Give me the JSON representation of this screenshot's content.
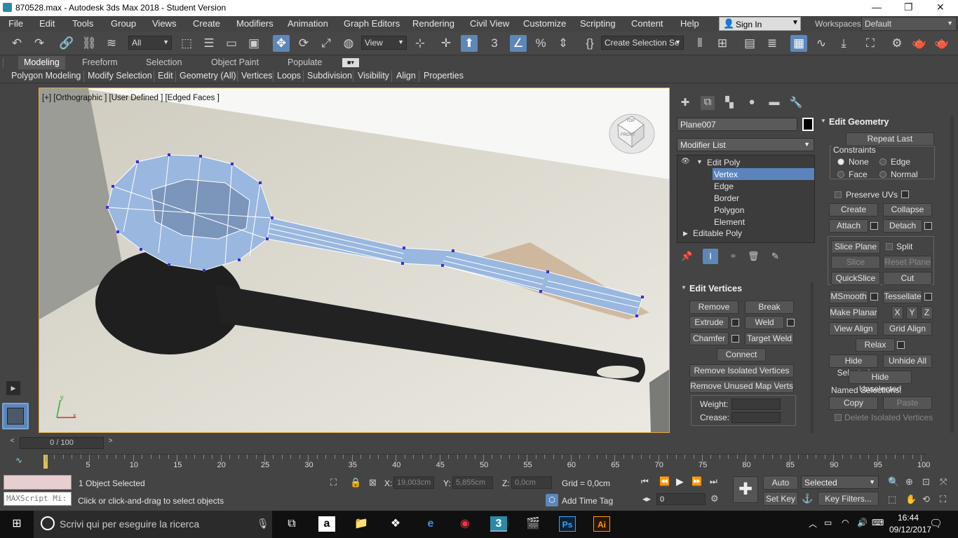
{
  "titlebar": {
    "title": "870528.max - Autodesk 3ds Max 2018 - Student Version",
    "minimize": "—",
    "maximize": "❐",
    "close": "✕"
  },
  "menubar": {
    "items": [
      "File",
      "Edit",
      "Tools",
      "Group",
      "Views",
      "Create",
      "Modifiers",
      "Animation",
      "Graph Editors",
      "Rendering",
      "Civil View",
      "Customize",
      "Scripting",
      "Content",
      "Help"
    ],
    "signin": "Sign In",
    "workspaces_label": "Workspaces:",
    "workspace": "Default"
  },
  "toolbar": {
    "filter": "All",
    "view": "View",
    "selection_set": "Create Selection Se",
    "snaps_3": "3"
  },
  "ribbon": {
    "tabs": [
      "Modeling",
      "Freeform",
      "Selection",
      "Object Paint",
      "Populate"
    ],
    "sub": [
      "Polygon Modeling",
      "Modify Selection",
      "Edit",
      "Geometry (All)",
      "Vertices",
      "Loops",
      "Subdivision",
      "Visibility",
      "Align",
      "Properties"
    ]
  },
  "viewport": {
    "label": "[+] [Orthographic ] [User Defined ] [Edged Faces ]",
    "viewcube_top": "TOP",
    "viewcube_front": "FRONT",
    "axis_x": "x",
    "axis_y": "y"
  },
  "cmdpanel": {
    "object_name": "Plane007",
    "modifier_list": "Modifier List",
    "stack": [
      "Edit Poly",
      "Vertex",
      "Edge",
      "Border",
      "Polygon",
      "Element",
      "Editable Poly"
    ],
    "edit_vertices": {
      "title": "Edit Vertices",
      "remove": "Remove",
      "break": "Break",
      "extrude": "Extrude",
      "weld": "Weld",
      "chamfer": "Chamfer",
      "target_weld": "Target Weld",
      "connect": "Connect",
      "remove_isolated": "Remove Isolated Vertices",
      "remove_unused": "Remove Unused Map Verts",
      "weight": "Weight:",
      "crease": "Crease:"
    },
    "edit_geometry": {
      "title": "Edit Geometry",
      "repeat_last": "Repeat Last",
      "constraints": "Constraints",
      "none": "None",
      "edge": "Edge",
      "face": "Face",
      "normal": "Normal",
      "preserve_uvs": "Preserve UVs",
      "create": "Create",
      "collapse": "Collapse",
      "attach": "Attach",
      "detach": "Detach",
      "slice_plane": "Slice Plane",
      "split": "Split",
      "slice": "Slice",
      "reset_plane": "Reset Plane",
      "quickslice": "QuickSlice",
      "cut": "Cut",
      "msmooth": "MSmooth",
      "tessellate": "Tessellate",
      "make_planar": "Make Planar",
      "x": "X",
      "y": "Y",
      "z": "Z",
      "view_align": "View Align",
      "grid_align": "Grid Align",
      "relax": "Relax",
      "hide_selected": "Hide Selected",
      "unhide_all": "Unhide All",
      "hide_unselected": "Hide Unselected",
      "named_selections": "Named Selections:",
      "copy": "Copy",
      "paste": "Paste",
      "delete_isolated": "Delete Isolated Vertices"
    }
  },
  "timeline": {
    "frame": "0 / 100",
    "ticks": [
      "0",
      "5",
      "10",
      "15",
      "20",
      "25",
      "30",
      "35",
      "40",
      "45",
      "50",
      "55",
      "60",
      "65",
      "70",
      "75",
      "80",
      "85",
      "90",
      "95",
      "100"
    ]
  },
  "status": {
    "maxscript": "MAXScript Mi:",
    "selected": "1 Object Selected",
    "prompt": "Click or click-and-drag to select objects",
    "x_label": "X:",
    "x_val": "19,003cm",
    "y_label": "Y:",
    "y_val": "5,855cm",
    "z_label": "Z:",
    "z_val": "0,0cm",
    "grid": "Grid = 0,0cm",
    "add_time_tag": "Add Time Tag",
    "auto_key": "Auto Key",
    "set_key": "Set Key",
    "selected_dd": "Selected",
    "key_filters": "Key Filters...",
    "frame_field": "0"
  },
  "taskbar": {
    "search": "Scrivi qui per eseguire la ricerca",
    "time": "16:44",
    "date": "09/12/2017"
  }
}
